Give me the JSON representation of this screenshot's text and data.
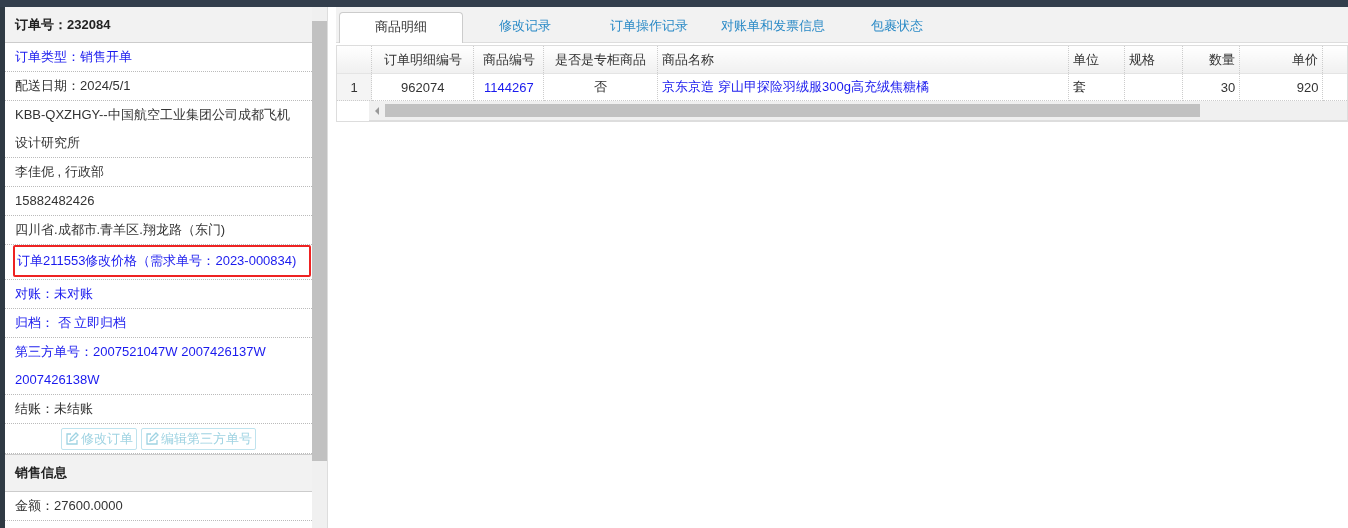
{
  "order_panel": {
    "title": "订单号：232084",
    "rows": [
      {
        "text": "订单类型：销售开单",
        "kind": "link",
        "highlighted": false
      },
      {
        "text": "配送日期：2024/5/1",
        "kind": "plain",
        "highlighted": false
      },
      {
        "text": "KBB-QXZHGY--中国航空工业集团公司成都飞机设计研究所",
        "kind": "plain",
        "highlighted": false
      },
      {
        "text": "李佳伲 , 行政部",
        "kind": "plain",
        "highlighted": false
      },
      {
        "text": "15882482426",
        "kind": "plain",
        "highlighted": false
      },
      {
        "text": "四川省.成都市.青羊区.翔龙路（东门)",
        "kind": "plain",
        "highlighted": false
      },
      {
        "text": "订单211553修改价格（需求单号：2023-000834)",
        "kind": "link",
        "highlighted": true
      },
      {
        "text": "对账：未对账",
        "kind": "link",
        "highlighted": false
      },
      {
        "text": "归档：  否 立即归档",
        "kind": "link",
        "highlighted": false
      },
      {
        "text": "第三方单号：2007521047W 2007426137W 2007426138W",
        "kind": "link",
        "highlighted": false
      },
      {
        "text": "结账：未结账",
        "kind": "plain",
        "highlighted": false
      }
    ],
    "buttons": [
      {
        "label": "修改订单",
        "disabled": true
      },
      {
        "label": "编辑第三方单号",
        "disabled": true
      }
    ],
    "section_title": "销售信息",
    "amount": "金额：27600.0000"
  },
  "tabs": [
    {
      "label": "商品明细",
      "selected": true
    },
    {
      "label": "修改记录",
      "selected": false
    },
    {
      "label": "订单操作记录",
      "selected": false
    },
    {
      "label": "对账单和发票信息",
      "selected": false
    },
    {
      "label": "包裹状态",
      "selected": false
    }
  ],
  "table": {
    "columns": [
      {
        "label": "订单明细编号"
      },
      {
        "label": "商品编号"
      },
      {
        "label": "是否是专柜商品"
      },
      {
        "label": "商品名称"
      },
      {
        "label": "单位"
      },
      {
        "label": "规格"
      },
      {
        "label": "数量"
      },
      {
        "label": "单价"
      }
    ],
    "rows": [
      {
        "row_number": "1",
        "cells": [
          {
            "text": "962074",
            "kind": "plain"
          },
          {
            "text": "1144267",
            "kind": "link"
          },
          {
            "text": "否",
            "kind": "plain"
          },
          {
            "text": "京东京造 穿山甲探险羽绒服300g高充绒焦糖橘",
            "kind": "link"
          },
          {
            "text": "套",
            "kind": "plain"
          },
          {
            "kind": "plain"
          },
          {
            "text": "30",
            "kind": "plain"
          },
          {
            "text": "920",
            "kind": "plain"
          }
        ]
      }
    ]
  }
}
